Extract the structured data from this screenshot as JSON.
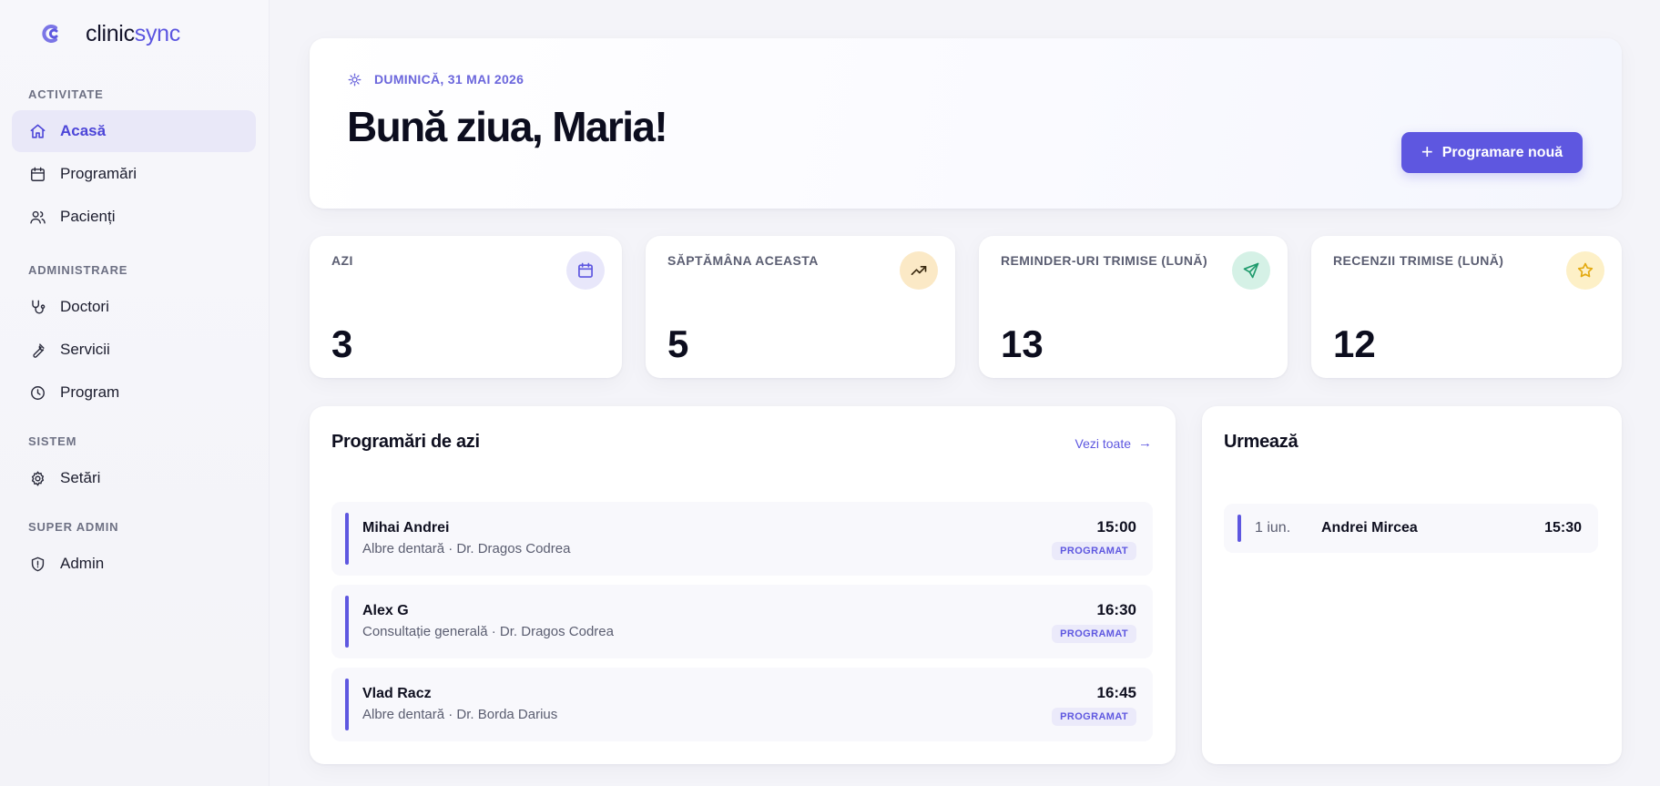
{
  "brand": {
    "name_prefix": "clinic",
    "name_suffix": "sync"
  },
  "colors": {
    "accent": "#5e57e0",
    "active_bg": "#e9e8f8"
  },
  "sidebar": {
    "sections": [
      {
        "label": "ACTIVITATE"
      },
      {
        "label": "ADMINISTRARE"
      },
      {
        "label": "SISTEM"
      },
      {
        "label": "SUPER ADMIN"
      }
    ],
    "items": [
      {
        "label": "Acasă",
        "icon": "home-icon",
        "active": true
      },
      {
        "label": "Programări",
        "icon": "calendar-icon"
      },
      {
        "label": "Pacienți",
        "icon": "users-icon"
      },
      {
        "label": "Doctori",
        "icon": "stethoscope-icon"
      },
      {
        "label": "Servicii",
        "icon": "wrench-icon"
      },
      {
        "label": "Program",
        "icon": "clock-icon"
      },
      {
        "label": "Setări",
        "icon": "gear-icon"
      },
      {
        "label": "Admin",
        "icon": "shield-icon"
      }
    ]
  },
  "hero": {
    "date": "DUMINICĂ, 31 MAI 2026",
    "greeting": "Bună ziua, Maria!",
    "new_button": "Programare nouă"
  },
  "stats": [
    {
      "label": "AZI",
      "value": "3",
      "icon": "calendar-icon"
    },
    {
      "label": "SĂPTĂMÂNA ACEASTA",
      "value": "5",
      "icon": "trending-up-icon"
    },
    {
      "label": "REMINDER-URI TRIMISE (LUNĂ)",
      "value": "13",
      "icon": "send-icon"
    },
    {
      "label": "RECENZII TRIMISE (LUNĂ)",
      "value": "12",
      "icon": "star-icon"
    }
  ],
  "today": {
    "title": "Programări de azi",
    "view_all": "Vezi toate",
    "appointments": [
      {
        "name": "Mihai Andrei",
        "details": "Albre dentară · Dr. Dragos Codrea",
        "time": "15:00",
        "status": "PROGRAMAT"
      },
      {
        "name": "Alex G",
        "details": "Consultație generală · Dr. Dragos Codrea",
        "time": "16:30",
        "status": "PROGRAMAT"
      },
      {
        "name": "Vlad Racz",
        "details": "Albre dentară · Dr. Borda Darius",
        "time": "16:45",
        "status": "PROGRAMAT"
      }
    ]
  },
  "upcoming": {
    "title": "Urmează",
    "items": [
      {
        "date": "1 iun.",
        "name": "Andrei Mircea",
        "time": "15:30"
      }
    ]
  }
}
